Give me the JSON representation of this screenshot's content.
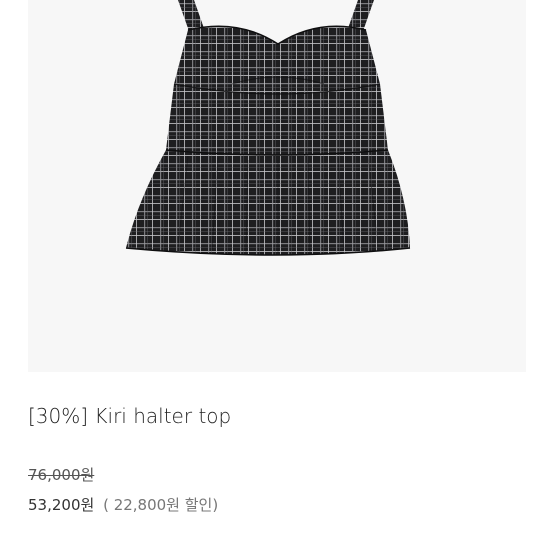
{
  "product": {
    "image_icon": "plaid-halter-top-photo",
    "title": "[30%] Kiri halter top",
    "original_price": "76,000원",
    "sale_price": "53,200원",
    "discount_note": "( 22,800원 할인)"
  },
  "colors": {
    "image_background": "#f7f7f7",
    "fabric_dark": "#1e1e20",
    "fabric_light": "#c8c8cc",
    "text_primary": "#222222",
    "text_muted": "#777777"
  }
}
